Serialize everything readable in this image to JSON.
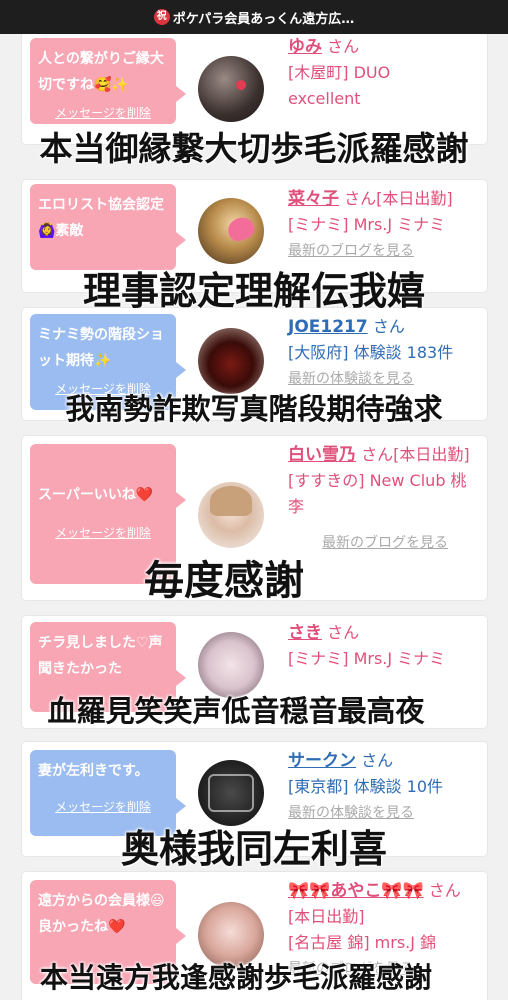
{
  "header": {
    "badge": "祝",
    "title": "ポケパラ会員あっくん遠方広…"
  },
  "delete_label": "メッセージを削除",
  "cards": [
    {
      "message": "人との繋がりご縁大切ですね🥰✨",
      "bubble_color": "pink",
      "name": "ゆみ",
      "san": "さん",
      "line2": "[木屋町] DUO",
      "line3": "excellent",
      "link": "",
      "overlay": "本当御縁繋大切歩毛派羅感謝"
    },
    {
      "message": "エロリスト協会認定🙆‍♀️素敵",
      "bubble_color": "pink",
      "name": "菜々子",
      "san": "さん[本日出勤]",
      "line2": "[ミナミ] Mrs.J ミナミ",
      "line3": "",
      "link": "最新のブログを見る",
      "overlay": "理事認定理解伝我嬉"
    },
    {
      "message": "ミナミ勢の階段ショット期待✨",
      "bubble_color": "blue",
      "name": "JOE1217",
      "san": "さん",
      "line2": "[大阪府] 体験談 183件",
      "line3": "",
      "link": "最新の体験談を見る",
      "overlay": "我南勢詐欺写真階段期待強求"
    },
    {
      "message": "スーパーいいね❤️",
      "bubble_color": "pink",
      "name": "白い雪乃",
      "san": "さん[本日出勤]",
      "line2": "[すすきの] New Club 桃李",
      "line3": "",
      "link": "最新のブログを見る",
      "overlay": "毎度感謝"
    },
    {
      "message": "チラ見しました♡声聞きたかった",
      "bubble_color": "pink",
      "name": "さき",
      "san": "さん",
      "line2": "[ミナミ] Mrs.J ミナミ",
      "line3": "",
      "link": "最新のブログを見る",
      "overlay": "血羅見笑笑声低音穏音最高夜"
    },
    {
      "message": "妻が左利きです。",
      "bubble_color": "blue",
      "name": "サークン",
      "san": "さん",
      "line2": "[東京都] 体験談 10件",
      "line3": "",
      "link": "最新の体験談を見る",
      "overlay": "奥様我同左利喜"
    },
    {
      "message": "遠方からの会員様😃良かったね❤️",
      "bubble_color": "pink",
      "name": "🎀🎀あやこ🎀🎀",
      "san": "さん[本日出勤]",
      "line2": "[名古屋 錦] mrs.J 錦",
      "line3": "",
      "link": "最新のブログを見る",
      "overlay": "本当遠方我逢感謝歩毛派羅感謝"
    }
  ],
  "colors": {
    "pink_bubble": "#f8a5b4",
    "blue_bubble": "#9bbcf0",
    "pink_text": "#e0507a",
    "blue_text": "#2f6cb6"
  }
}
